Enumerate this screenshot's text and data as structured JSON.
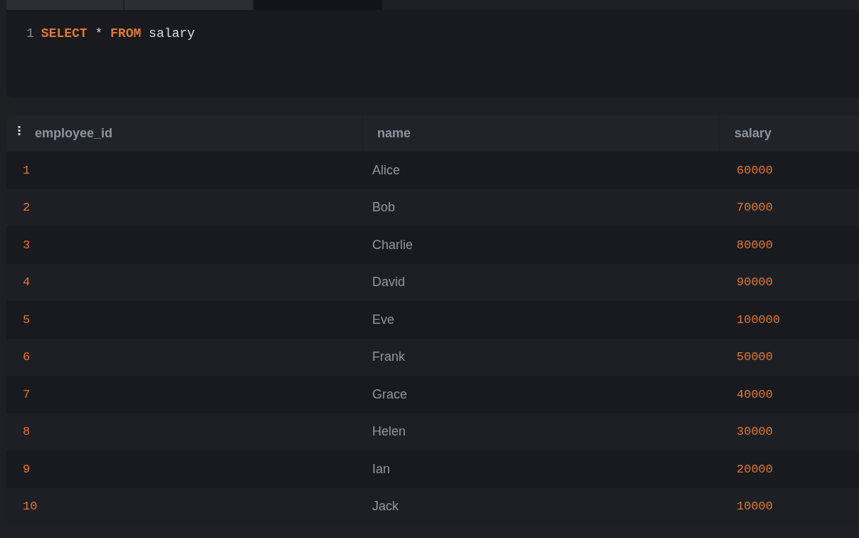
{
  "tab_strip": {
    "tabs": [
      {
        "selected": false
      },
      {
        "selected": false
      },
      {
        "selected": true
      }
    ]
  },
  "editor": {
    "lines": [
      {
        "number": "1",
        "tokens": [
          {
            "kind": "keyword",
            "text": "SELECT"
          },
          {
            "kind": "operator",
            "text": "*"
          },
          {
            "kind": "keyword",
            "text": "FROM"
          },
          {
            "kind": "identifier",
            "text": "salary"
          }
        ]
      }
    ]
  },
  "table": {
    "columns": [
      {
        "label": "employee_id",
        "kind": "number"
      },
      {
        "label": "name",
        "kind": "text"
      },
      {
        "label": "salary",
        "kind": "number"
      }
    ],
    "rows": [
      [
        "1",
        "Alice",
        "60000"
      ],
      [
        "2",
        "Bob",
        "70000"
      ],
      [
        "3",
        "Charlie",
        "80000"
      ],
      [
        "4",
        "David",
        "90000"
      ],
      [
        "5",
        "Eve",
        "100000"
      ],
      [
        "6",
        "Frank",
        "50000"
      ],
      [
        "7",
        "Grace",
        "40000"
      ],
      [
        "8",
        "Helen",
        "30000"
      ],
      [
        "9",
        "Ian",
        "20000"
      ],
      [
        "10",
        "Jack",
        "10000"
      ]
    ]
  }
}
